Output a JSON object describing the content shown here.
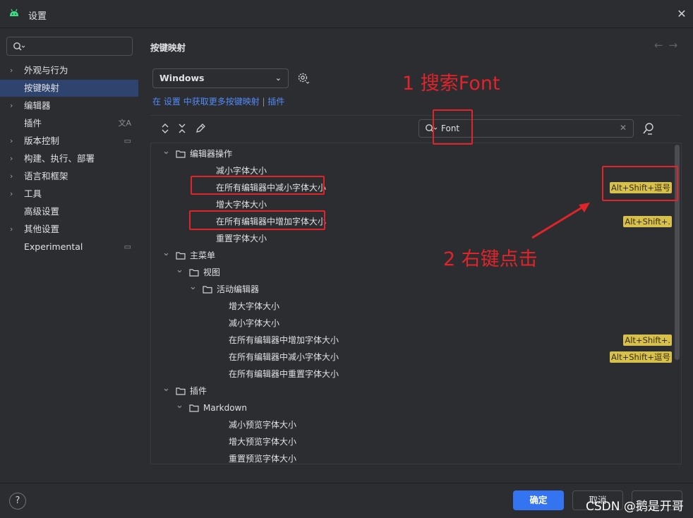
{
  "window": {
    "title": "设置",
    "close_icon": "close-icon"
  },
  "sidebar": {
    "search_placeholder": "",
    "items": [
      {
        "label": "外观与行为",
        "expandable": true,
        "selected": false,
        "badge": ""
      },
      {
        "label": "按键映射",
        "expandable": false,
        "selected": true,
        "badge": ""
      },
      {
        "label": "编辑器",
        "expandable": true,
        "selected": false,
        "badge": ""
      },
      {
        "label": "插件",
        "expandable": false,
        "selected": false,
        "badge": "translate-icon"
      },
      {
        "label": "版本控制",
        "expandable": true,
        "selected": false,
        "badge": "project-icon"
      },
      {
        "label": "构建、执行、部署",
        "expandable": true,
        "selected": false,
        "badge": ""
      },
      {
        "label": "语言和框架",
        "expandable": true,
        "selected": false,
        "badge": ""
      },
      {
        "label": "工具",
        "expandable": true,
        "selected": false,
        "badge": ""
      },
      {
        "label": "高级设置",
        "expandable": false,
        "selected": false,
        "badge": ""
      },
      {
        "label": "其他设置",
        "expandable": true,
        "selected": false,
        "badge": ""
      },
      {
        "label": "Experimental",
        "expandable": false,
        "selected": false,
        "badge": "project-icon"
      }
    ]
  },
  "main": {
    "title": "按键映射",
    "keymap": "Windows",
    "link_prefix": "在",
    "link_settings": "设置",
    "link_middle": "中获取更多按键映射",
    "link_sep": "|",
    "link_plugins": "插件",
    "search_value": "Font",
    "tree": [
      {
        "label": "编辑器操作",
        "level": 0,
        "type": "group",
        "shortcut": ""
      },
      {
        "label": "减小字体大小",
        "level": 1,
        "type": "action",
        "shortcut": ""
      },
      {
        "label": "在所有编辑器中减小字体大小",
        "level": 1,
        "type": "action",
        "shortcut": "Alt+Shift+逗号"
      },
      {
        "label": "增大字体大小",
        "level": 1,
        "type": "action",
        "shortcut": ""
      },
      {
        "label": "在所有编辑器中增加字体大小",
        "level": 1,
        "type": "action",
        "shortcut": "Alt+Shift+."
      },
      {
        "label": "重置字体大小",
        "level": 1,
        "type": "action",
        "shortcut": ""
      },
      {
        "label": "主菜单",
        "level": 0,
        "type": "group",
        "shortcut": ""
      },
      {
        "label": "视图",
        "level": 1,
        "type": "group",
        "shortcut": ""
      },
      {
        "label": "活动编辑器",
        "level": 2,
        "type": "group",
        "shortcut": ""
      },
      {
        "label": "增大字体大小",
        "level": 3,
        "type": "action",
        "shortcut": ""
      },
      {
        "label": "减小字体大小",
        "level": 3,
        "type": "action",
        "shortcut": ""
      },
      {
        "label": "在所有编辑器中增加字体大小",
        "level": 2,
        "type": "action",
        "shortcut": "Alt+Shift+."
      },
      {
        "label": "在所有编辑器中减小字体大小",
        "level": 2,
        "type": "action",
        "shortcut": "Alt+Shift+逗号"
      },
      {
        "label": "在所有编辑器中重置字体大小",
        "level": 2,
        "type": "action",
        "shortcut": ""
      },
      {
        "label": "插件",
        "level": 0,
        "type": "group",
        "shortcut": ""
      },
      {
        "label": "Markdown",
        "level": 1,
        "type": "group",
        "shortcut": ""
      },
      {
        "label": "减小预览字体大小",
        "level": 2,
        "type": "action",
        "shortcut": ""
      },
      {
        "label": "增大预览字体大小",
        "level": 2,
        "type": "action",
        "shortcut": ""
      },
      {
        "label": "重置预览字体大小",
        "level": 2,
        "type": "action",
        "shortcut": ""
      }
    ]
  },
  "footer": {
    "help": "?",
    "ok": "确定",
    "cancel": "取消",
    "apply": "",
    "watermark": "CSDN @鹅是开哥"
  },
  "annotations": {
    "step1": "1 搜索Font",
    "step2": "2 右键点击",
    "color": "#e0242a"
  },
  "colors": {
    "accent": "#3574f0",
    "selection": "#2e436e",
    "shortcut_bg": "#d8c04d",
    "link": "#548af7"
  }
}
